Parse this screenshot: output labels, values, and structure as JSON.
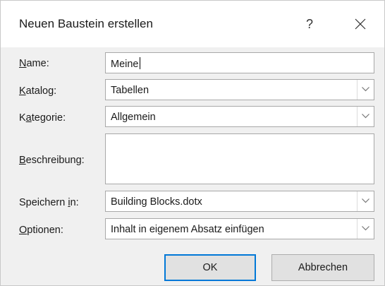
{
  "dialog": {
    "title": "Neuen Baustein erstellen",
    "help_label": "?",
    "close_icon": "close-icon"
  },
  "fields": {
    "name": {
      "label_key": "N",
      "label_rest": "ame:",
      "value": "Meine"
    },
    "katalog": {
      "label_key": "K",
      "label_rest": "atalog:",
      "value": "Tabellen"
    },
    "kategorie": {
      "label_pre": "K",
      "label_key": "a",
      "label_rest": "tegorie:",
      "value": "Allgemein"
    },
    "beschreibung": {
      "label_key": "B",
      "label_rest": "eschreibung:",
      "value": ""
    },
    "speichern": {
      "label_pre": "Speichern ",
      "label_key": "i",
      "label_rest": "n:",
      "value": "Building Blocks.dotx"
    },
    "optionen": {
      "label_key": "O",
      "label_rest": "ptionen:",
      "value": "Inhalt in eigenem Absatz einfügen"
    }
  },
  "buttons": {
    "ok": "OK",
    "cancel": "Abbrechen"
  },
  "colors": {
    "accent": "#0078d7",
    "dialog_bg": "#f0f0f0",
    "titlebar_bg": "#ffffff"
  }
}
